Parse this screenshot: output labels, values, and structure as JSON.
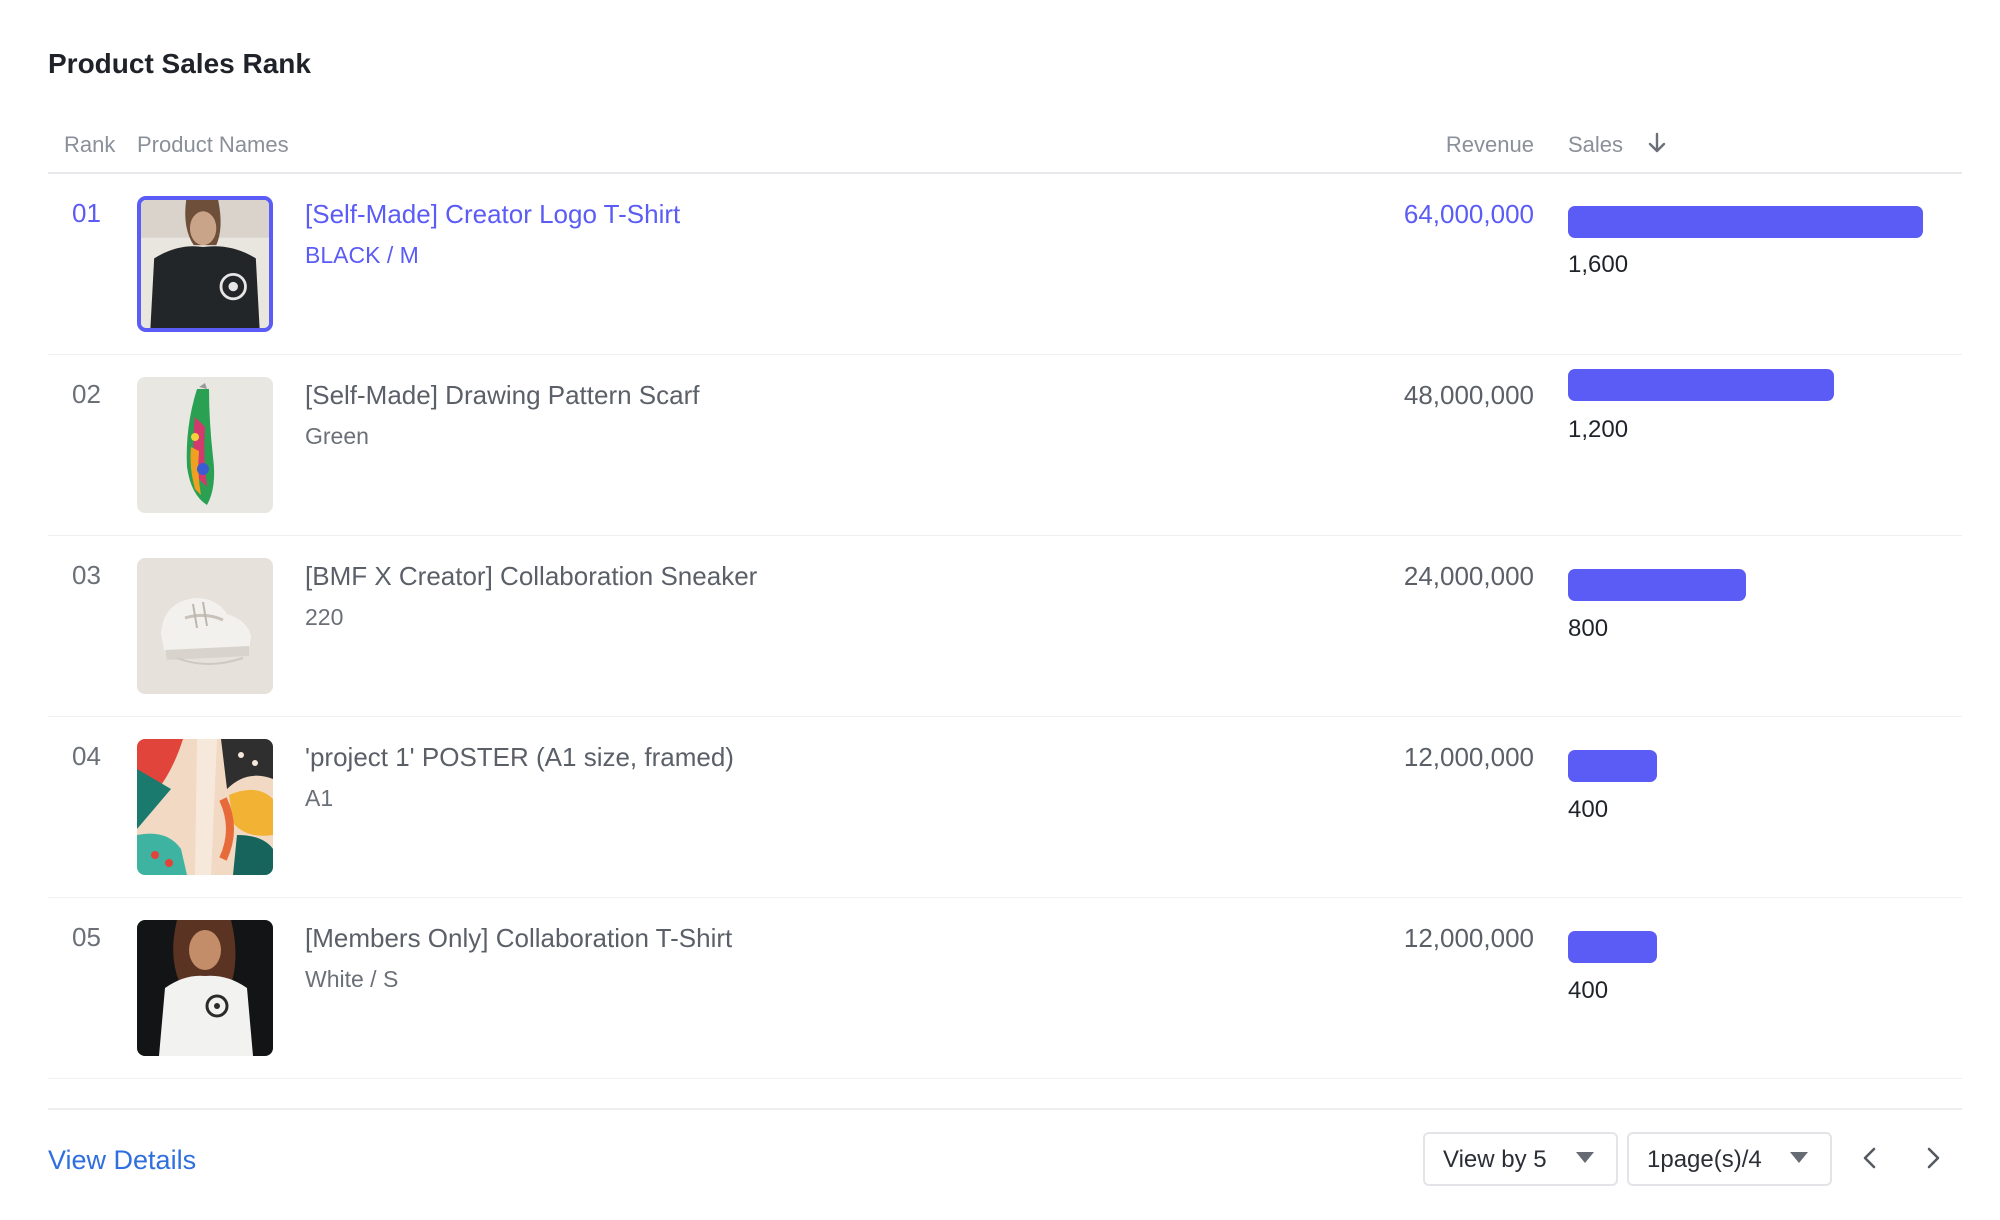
{
  "title": "Product Sales Rank",
  "columns": {
    "rank": "Rank",
    "product_names": "Product Names",
    "revenue": "Revenue",
    "sales": "Sales"
  },
  "sort_icon": "arrow-down-icon",
  "accent_color": "#5b5bf5",
  "link_color": "#2f6fde",
  "rows": [
    {
      "rank": "01",
      "name": "[Self-Made] Creator Logo T-Shirt",
      "option": "BLACK / M",
      "revenue": "64,000,000",
      "sales": "1,600",
      "sales_value": 1600,
      "image": "black-tshirt-photo",
      "highlighted": true
    },
    {
      "rank": "02",
      "name": "[Self-Made] Drawing Pattern Scarf",
      "option": "Green",
      "revenue": "48,000,000",
      "sales": "1,200",
      "sales_value": 1200,
      "image": "pattern-scarf-photo",
      "highlighted": false
    },
    {
      "rank": "03",
      "name": "[BMF X Creator] Collaboration Sneaker",
      "option": "220",
      "revenue": "24,000,000",
      "sales": "800",
      "sales_value": 800,
      "image": "white-sneaker-photo",
      "highlighted": false
    },
    {
      "rank": "04",
      "name": "'project 1' POSTER (A1 size, framed)",
      "option": "A1",
      "revenue": "12,000,000",
      "sales": "400",
      "sales_value": 400,
      "image": "abstract-poster-photo",
      "highlighted": false
    },
    {
      "rank": "05",
      "name": "[Members Only] Collaboration T-Shirt",
      "option": "White / S",
      "revenue": "12,000,000",
      "sales": "400",
      "sales_value": 400,
      "image": "white-tshirt-photo",
      "highlighted": false
    }
  ],
  "footer": {
    "view_details": "View Details",
    "view_by": "View by 5",
    "page": "1page(s)/4",
    "prev_icon": "chevron-left-icon",
    "next_icon": "chevron-right-icon"
  }
}
